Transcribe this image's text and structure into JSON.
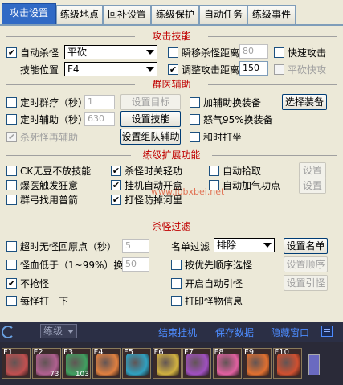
{
  "tabs": [
    "攻击设置",
    "练级地点",
    "回补设置",
    "练级保护",
    "自动任务",
    "练级事件"
  ],
  "attack": {
    "title": "攻击技能",
    "auto_kill_label": "自动杀怪",
    "auto_kill_checked": true,
    "skill_select": "平砍",
    "skill_pos_label": "技能位置",
    "skill_pos_select": "F4",
    "teleport_label": "瞬移杀怪距离",
    "teleport_value": "80",
    "adjust_label": "调整攻击距离",
    "adjust_value": "150",
    "quick_attack_label": "快速攻击",
    "plain_quick_label": "平砍快攻"
  },
  "support": {
    "title": "群医辅助",
    "timed_heal_label": "定时群疗（秒）",
    "timed_heal_value": "1",
    "set_target_btn": "设置目标",
    "add_aux_label": "加辅助换装备",
    "select_equip_btn": "选择装备",
    "timed_aux_label": "定时辅助（秒）",
    "timed_aux_value": "630",
    "set_skill_btn": "设置技能",
    "rage_label": "怒气95%换装备",
    "kill_monster_aux_label": "杀死怪再辅助",
    "set_team_aux_btn": "设置组队辅助",
    "dance_label": "和时打坐"
  },
  "extend": {
    "title": "练级扩展功能",
    "ck_label": "CK无豆不放技能",
    "kill_light_label": "杀怪时关轻功",
    "auto_pickup_label": "自动拾取",
    "settings1_btn": "设置",
    "burst_label": "爆医触发狂意",
    "auto_open_label": "挂机自动开盒",
    "auto_qi_label": "自动加气功点",
    "settings2_btn": "设置",
    "bow_label": "群弓找用普箭",
    "defense_label": "打怪防掉河里"
  },
  "watermark": "www.jbbxbei.net",
  "kill_filter": {
    "title": "杀怪过滤",
    "timeout_label": "超时无怪回原点（秒）",
    "timeout_value": "5",
    "namelist_label": "名单过滤",
    "namelist_select": "排除",
    "set_namelist_btn": "设置名单",
    "low_hp_label": "怪血低于（1~99%）换怪",
    "low_hp_value": "50",
    "priority_label": "按优先顺序选怪",
    "set_order_btn": "设置顺序",
    "no_grab_label": "不抢怪",
    "no_grab_checked": true,
    "auto_lure_label": "开启自动引怪",
    "set_lure_btn": "设置引怪",
    "hit_every_label": "每怪打一下",
    "print_info_label": "打印怪物信息"
  },
  "bottom": {
    "mode_select": "练级",
    "end_btn": "结束挂机",
    "save_btn": "保存数据",
    "hide_btn": "隐藏窗口"
  },
  "hotbar": [
    {
      "key": "F1",
      "count": "",
      "color": "#c05050"
    },
    {
      "key": "F2",
      "count": "73",
      "color": "#b06090"
    },
    {
      "key": "F3",
      "count": "103",
      "color": "#40a060"
    },
    {
      "key": "F4",
      "count": "",
      "color": "#e08040"
    },
    {
      "key": "F5",
      "count": "",
      "color": "#30a0c0"
    },
    {
      "key": "F6",
      "count": "",
      "color": "#d0b040"
    },
    {
      "key": "F7",
      "count": "",
      "color": "#a050c0"
    },
    {
      "key": "F8",
      "count": "",
      "color": "#e060a0"
    },
    {
      "key": "F9",
      "count": "",
      "color": "#e07030"
    },
    {
      "key": "F10",
      "count": "",
      "color": "#d05030"
    }
  ]
}
